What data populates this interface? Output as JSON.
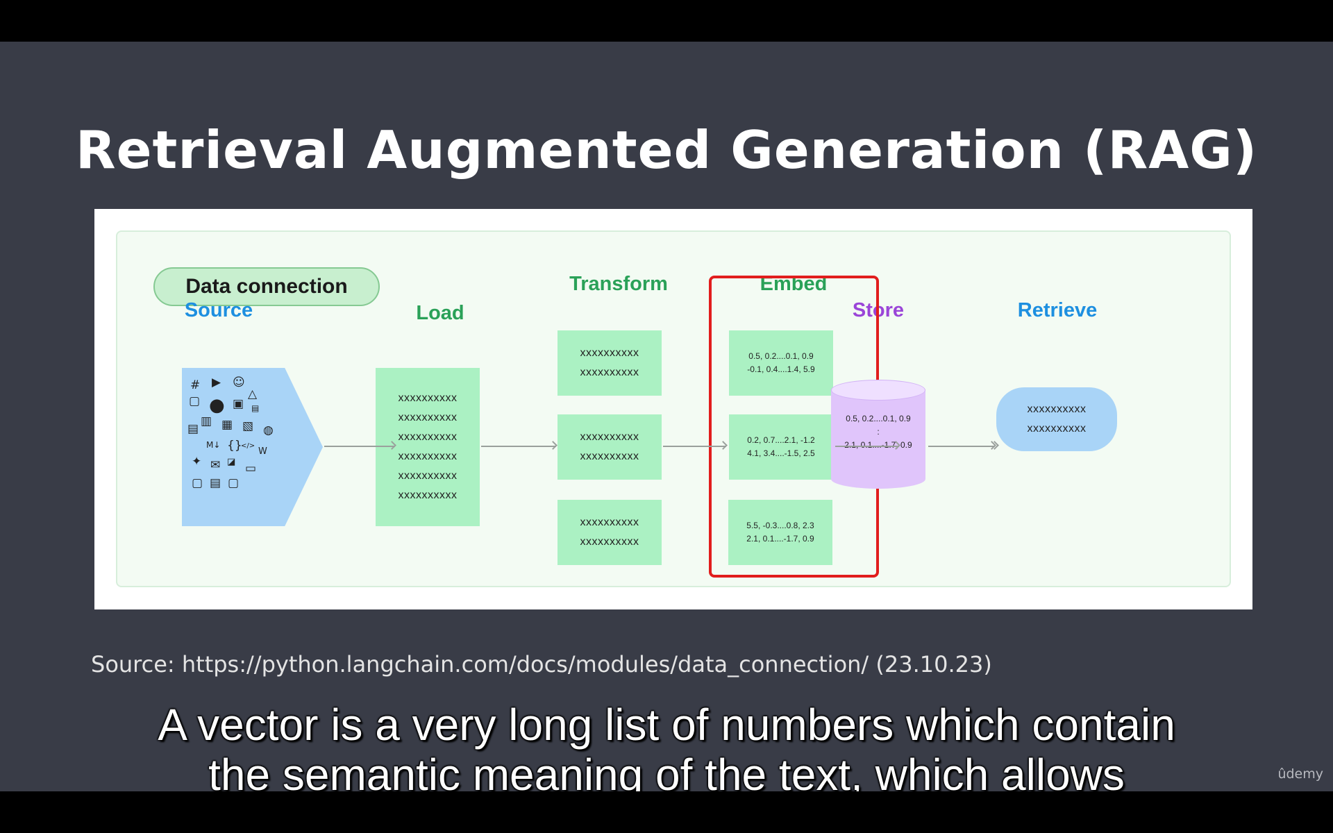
{
  "title": "Retrieval Augmented Generation (RAG)",
  "diagram": {
    "group_label": "Data connection",
    "stages": {
      "source": "Source",
      "load": "Load",
      "transform": "Transform",
      "embed": "Embed",
      "store": "Store",
      "retrieve": "Retrieve"
    },
    "source_icons": [
      "slack-icon",
      "youtube-icon",
      "discord-icon",
      "file-icon",
      "github-icon",
      "image-icon",
      "drive-icon",
      "csv-icon",
      "doc-icon",
      "pdf-icon",
      "xls-icon",
      "txt-icon",
      "ppt-icon",
      "markdown-icon",
      "json-icon",
      "html-icon",
      "wikipedia-icon",
      "twitter-icon",
      "mail-icon",
      "css-icon",
      "folder-icon"
    ],
    "load_lines": [
      "xxxxxxxxxx",
      "xxxxxxxxxx",
      "xxxxxxxxxx",
      "xxxxxxxxxx",
      "xxxxxxxxxx",
      "xxxxxxxxxx"
    ],
    "transform_chunks": [
      [
        "xxxxxxxxxx",
        "xxxxxxxxxx"
      ],
      [
        "xxxxxxxxxx",
        "xxxxxxxxxx"
      ],
      [
        "xxxxxxxxxx",
        "xxxxxxxxxx"
      ]
    ],
    "embed_vectors": [
      [
        "0.5, 0.2....0.1, 0.9",
        "-0.1, 0.4....1.4, 5.9"
      ],
      [
        "0.2, 0.7....2.1, -1.2",
        "4.1, 3.4....-1.5, 2.5"
      ],
      [
        "5.5, -0.3....0.8, 2.3",
        "2.1, 0.1....-1.7, 0.9"
      ]
    ],
    "store_lines": [
      "0.5, 0.2....0.1, 0.9",
      ":",
      "2.1, 0.1....-1.7, 0.9"
    ],
    "retrieve_lines": [
      "xxxxxxxxxx",
      "xxxxxxxxxx"
    ],
    "colors": {
      "green_label": "#2aa158",
      "blue_label": "#1d8fe0",
      "purple_label": "#9a45d8",
      "highlight": "#e11d1d"
    }
  },
  "source_note": "Source: https://python.langchain.com/docs/modules/data_connection/ (23.10.23)",
  "caption": {
    "line1": "A vector is a very long list of numbers which contain",
    "line2": "the semantic meaning of the text, which allows"
  },
  "brand": "ûdemy"
}
